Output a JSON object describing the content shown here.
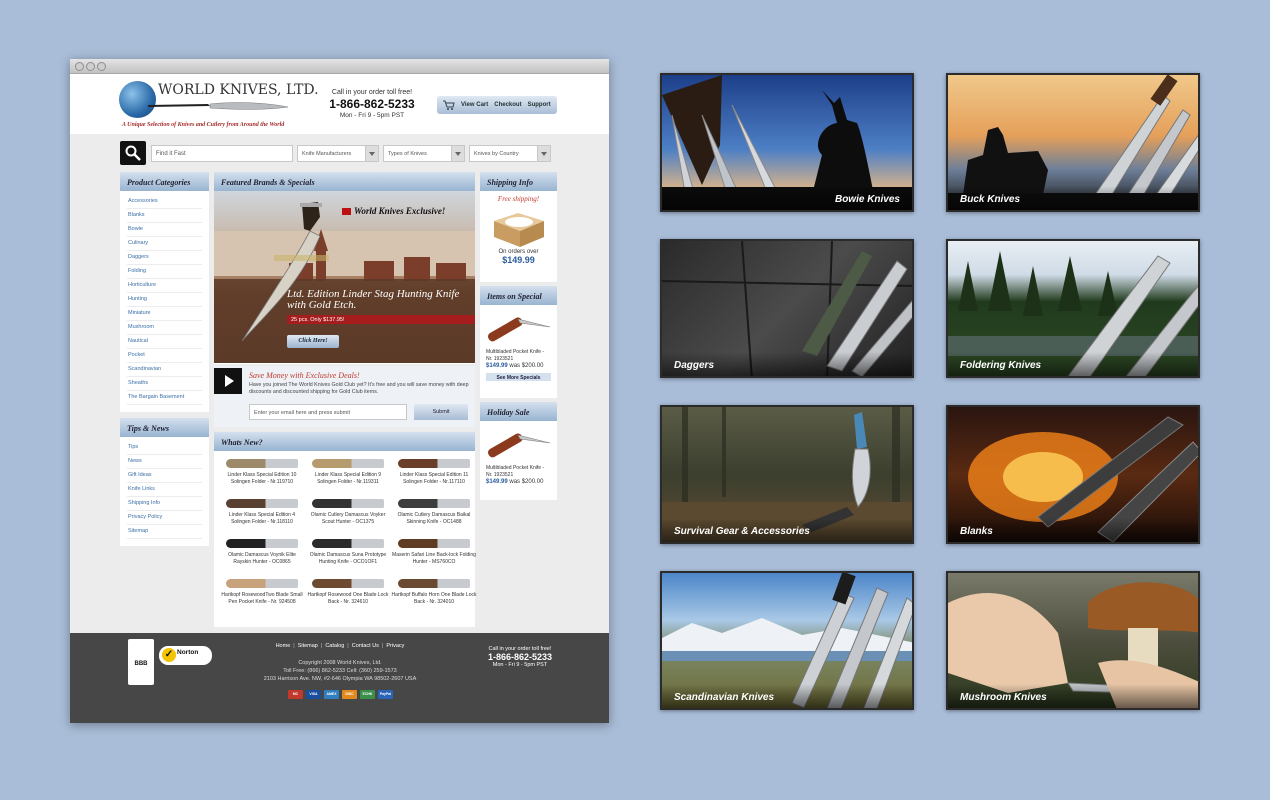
{
  "site": {
    "logo_text": "WORLD KNIVES, LTD.",
    "tagline": "A Unique Selection of Knives and Cutlery from Around the World",
    "call_label": "Call in your order toll free!",
    "phone": "1-866-862-5233",
    "hours": "Mon - Fri 9 - 5pm PST"
  },
  "cart": {
    "view_cart": "View Cart",
    "checkout": "Checkout",
    "support": "Support"
  },
  "search": {
    "placeholder": "Find it Fast",
    "dropdowns": [
      "Knife Manufacturers",
      "Types of Knives",
      "Knives by Country"
    ]
  },
  "categories": {
    "title": "Product Categories",
    "items": [
      "Accessories",
      "Blanks",
      "Bowie",
      "Culinary",
      "Daggers",
      "Folding",
      "Horticulture",
      "Hunting",
      "Miniature",
      "Mushroom",
      "Nautical",
      "Pocket",
      "Scandinavian",
      "Sheaths",
      "The Bargain Basement"
    ]
  },
  "tips": {
    "title": "Tips & News",
    "items": [
      "Tips",
      "News",
      "Gift Ideas",
      "Knife Links",
      "Shipping Info",
      "Privacy Policy",
      "Sitemap"
    ]
  },
  "featured": {
    "title": "Featured Brands & Specials",
    "exclusive": "World Knives Exclusive!",
    "headline": "Ltd. Edition Linder Stag Hunting Knife with Gold Etch.",
    "ribbon": "25 pcs.   Only $137.95!",
    "cta": "Click Here!"
  },
  "club": {
    "title": "Save Money with Exclusive Deals!",
    "desc": "Have you joined The World Knives Gold Club yet? It's free and you will save money with deep discounts and discounted shipping for Gold Club items.",
    "email_placeholder": "Enter your email here and press submit",
    "submit": "Submit"
  },
  "whats_new": {
    "title": "Whats New?",
    "products": [
      "Linder Klass Special Edition 10 Solingen Folder - Nr.119710",
      "Linder Klass Special Edition 9 Solingen Folder - Nr.119311",
      "Linder Klass Special Edition 11 Solingen Folder - Nr.117110",
      "Linder Klass Special Edition 4 Solingen Folder - Nr.118110",
      "Olamic Cutlery Damascus Voyker Scout Hunter - OC1375",
      "Olamic Cutlery Damascus Baikal Skinning Knife - OC1488",
      "Olamic Damascus Voynik Elite Rayskin Hunter - OC0865",
      "Olamic Damascus Suna Prototype Hunting Knife - OCO1OF1",
      "Maserin Safari Line Back-lock Folding Hunter - MS760CO",
      "Hartkopf RosewoodTwo Blade Small Pen Pocket Knife - Nr. 924508",
      "Hartkopf Rosewood One Blade Lock Back - Nr. 324610",
      "Hartkopf Buffalo Horn One Blade Lock Back - Nr. 324010"
    ]
  },
  "shipping": {
    "title": "Shipping Info",
    "free": "Free shipping!",
    "orders_over": "On orders over",
    "amount": "$149.99"
  },
  "special": {
    "title": "Items on Special",
    "name": "Multibladed Pocket Knife - Nr. 1923521",
    "price": "$149.99",
    "was": "was $200.00",
    "more": "See More Specials"
  },
  "holiday": {
    "title": "Holiday Sale",
    "name": "Multibladed Pocket Knife - Nr. 1923521",
    "price": "$149.99",
    "was": "was $200.00"
  },
  "footer": {
    "links": [
      "Home",
      "Sitemap",
      "Catalog",
      "Contact Us",
      "Privacy"
    ],
    "copyright": "Copyright 2008 World Knives, Ltd.",
    "tollfree": "Toll Free: (866) 862-5233    Cell: (360) 259-1573",
    "address": "2103 Harrison Ave. NW, #2-646 Olympia WA 98502-2607 USA",
    "bbb": "BBB",
    "norton": "Norton",
    "cards": [
      "MC",
      "VISA",
      "AMEX",
      "DISC",
      "ECHK",
      "PayPal"
    ]
  },
  "tiles": [
    "Bowie Knives",
    "Buck Knives",
    "Daggers",
    "Foldering Knives",
    "Survival Gear & Accessories",
    "Blanks",
    "Scandinavian Knives",
    "Mushroom Knives"
  ],
  "colors": {
    "background": "#a9bdd8",
    "panel_header": "#98b4d1",
    "link": "#3b6ea6",
    "accent_red": "#a51d1d",
    "footer": "#474747"
  }
}
